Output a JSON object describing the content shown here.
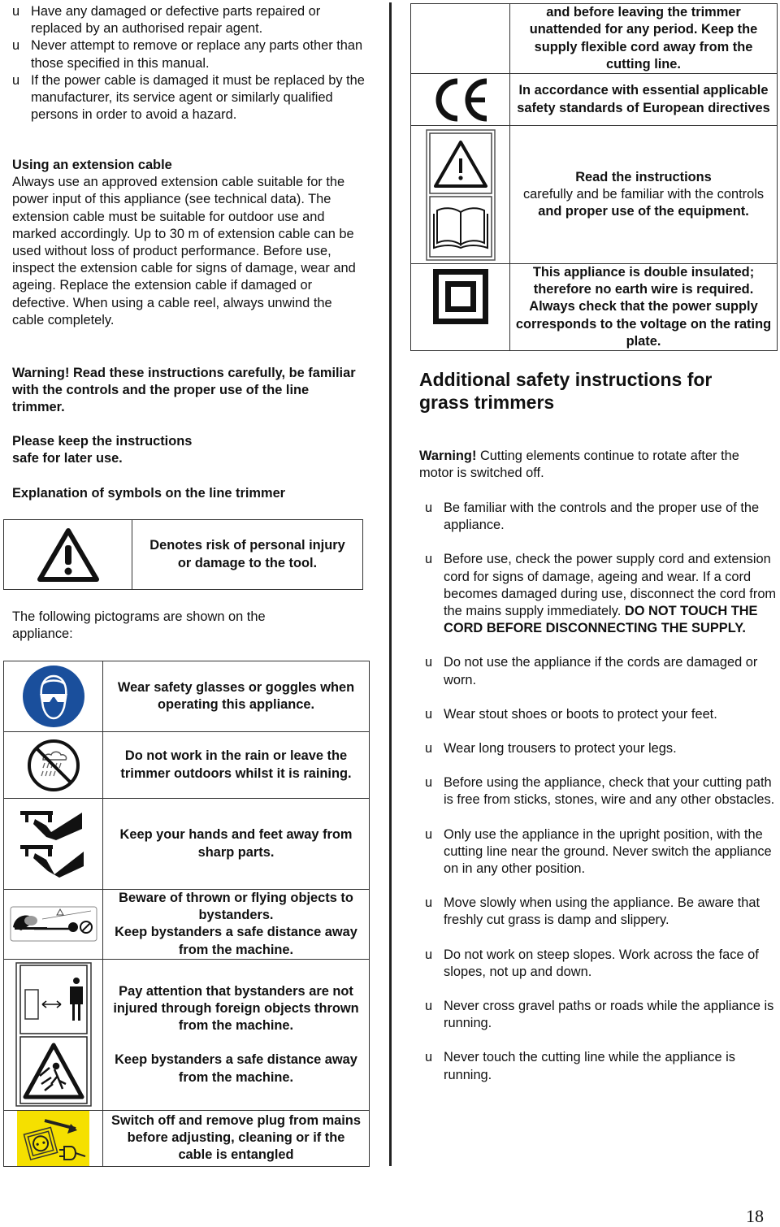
{
  "left": {
    "bullets_top": [
      "Have any damaged or defective parts repaired or replaced by an authorised repair agent.",
      "Never attempt to remove or replace any parts other than those specified in this manual.",
      "If the power cable is damaged it must be replaced by the manufacturer, its service agent or similarly qualified persons in order to avoid a hazard."
    ],
    "bullet_marker": "u",
    "extension": {
      "heading": "Using an extension cable",
      "body": "Always use an approved extension cable suitable for the power input of this appliance (see technical data). The extension cable must be suitable for outdoor use and marked accordingly. Up to 30 m of extension cable can be used without loss of product performance. Before use, inspect the extension cable for signs of damage, wear and ageing. Replace the extension cable if damaged or defective. When using a cable reel, always unwind the cable completely."
    },
    "warning": "Warning! Read these instructions carefully, be familiar with the controls and the proper use of the line trimmer.",
    "keep_line1": "Please keep the instructions",
    "keep_line2": "safe for later use.",
    "symbols_heading": "Explanation of symbols on the line trimmer",
    "risk_symbol": {
      "icon": "warning-triangle-icon",
      "text": "Denotes risk of personal injury or damage to the tool."
    },
    "pictograms_intro": "The following pictograms are shown on the appliance:",
    "pictograms": [
      {
        "icon": "safety-goggles-icon",
        "text": "Wear safety glasses or goggles when operating this appliance."
      },
      {
        "icon": "no-rain-icon",
        "text": "Do not work in the rain or leave the trimmer outdoors whilst it is raining."
      },
      {
        "icon": "hands-feet-away-icon",
        "text": "Keep your hands and feet away from sharp parts."
      },
      {
        "icon": "thrown-objects-icon",
        "text_l1": "Beware of thrown or flying objects to bystanders.",
        "text_l2": "Keep bystanders a safe distance away from the machine."
      },
      {
        "icon": "bystander-distance-icon",
        "text_l1": "Pay attention that bystanders are not injured through foreign objects thrown from the machine.",
        "text_l2": "Keep bystanders a safe distance away from the machine."
      },
      {
        "icon": "unplug-icon",
        "text": "Switch off and remove plug from mains before adjusting, cleaning or if the cable is entangled"
      }
    ]
  },
  "right": {
    "table": [
      {
        "icon": "",
        "text": "and before leaving the trimmer unattended for any period. Keep the supply flexible cord away from the cutting line."
      },
      {
        "icon": "ce-mark-icon",
        "text": "In accordance with essential applicable safety standards of European directives"
      },
      {
        "icon": "read-manual-icon",
        "text_bold1": "Read the instructions",
        "text_normal": "carefully and be familiar with the controls",
        "text_bold2": "and proper use of the equipment."
      },
      {
        "icon": "double-insulated-icon",
        "text": "This appliance is double insulated; therefore no earth wire is required. Always check that the power supply corresponds to the voltage on the rating plate."
      }
    ],
    "heading": "Additional safety instructions for grass trimmers",
    "warning_label": "Warning!",
    "warning_text": " Cutting elements continue to rotate after the motor is switched off.",
    "bullets": [
      {
        "text": "Be familiar with the controls and the proper use of the appliance."
      },
      {
        "text": "Before use, check the power supply cord and extension cord for signs of damage, ageing and wear. If a cord becomes damaged during use, disconnect the cord from the mains supply immediately. ",
        "bold": "DO NOT TOUCH THE CORD BEFORE DISCONNECTING THE SUPPLY."
      },
      {
        "text": "Do not use the appliance if the cords are damaged or worn."
      },
      {
        "text": "Wear stout shoes or boots to protect your feet."
      },
      {
        "text": "Wear long trousers to protect your legs."
      },
      {
        "text": "Before using the appliance, check that your cutting path is free from sticks, stones, wire and any other obstacles."
      },
      {
        "text": "Only use the appliance in the upright position, with the cutting line near the ground. Never switch the appliance on in any other position."
      },
      {
        "text": "Move slowly when using the appliance. Be aware that freshly cut grass is damp and slippery."
      },
      {
        "text": "Do not work on steep slopes. Work across the face of slopes, not up and down."
      },
      {
        "text": "Never cross gravel paths or roads while the appliance is running."
      },
      {
        "text": "Never touch the cutting line while the appliance is running."
      }
    ]
  },
  "page_number": "18",
  "colors": {
    "goggles_blue": "#1a4f9c",
    "unplug_yellow": "#f5e000"
  }
}
